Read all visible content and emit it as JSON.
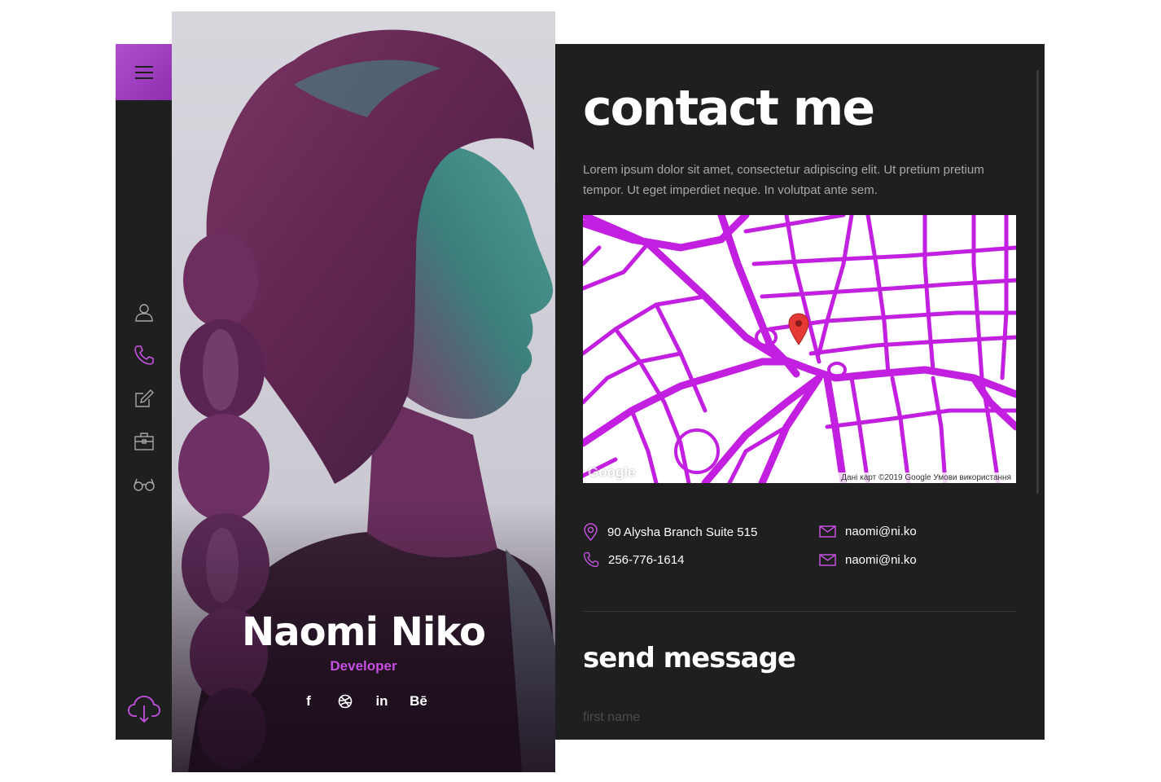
{
  "sidebar": {
    "menu_icon": "hamburger-menu-icon",
    "nav_icons": [
      "user-icon",
      "phone-icon",
      "edit-icon",
      "briefcase-icon",
      "glasses-icon"
    ],
    "download_icon": "cloud-download-icon",
    "accent": "#b04fd0"
  },
  "profile": {
    "name": "Naomi Niko",
    "role": "Developer",
    "socials": [
      {
        "icon": "facebook-icon",
        "label": "f"
      },
      {
        "icon": "dribbble-icon",
        "label": ""
      },
      {
        "icon": "linkedin-icon",
        "label": "in"
      },
      {
        "icon": "behance-icon",
        "label": "Bē"
      }
    ]
  },
  "contact": {
    "title": "contact me",
    "intro": "Lorem ipsum dolor sit amet, consectetur adipiscing elit. Ut pretium pretium tempor. Ut eget imperdiet neque. In volutpat ante sem.",
    "map": {
      "google_label": "Google",
      "attribution": "Дані карт ©2019 Google  Умови використання",
      "road_color": "#c21fe0"
    },
    "address": "90 Alysha Branch Suite 515",
    "phone": "256-776-1614",
    "email_1": "naomi@ni.ko",
    "email_2": "naomi@ni.ko",
    "send_title": "send message",
    "first_name_placeholder": "first name"
  },
  "colors": {
    "panel_bg": "#1e1f1f",
    "accent": "#c650e0"
  }
}
